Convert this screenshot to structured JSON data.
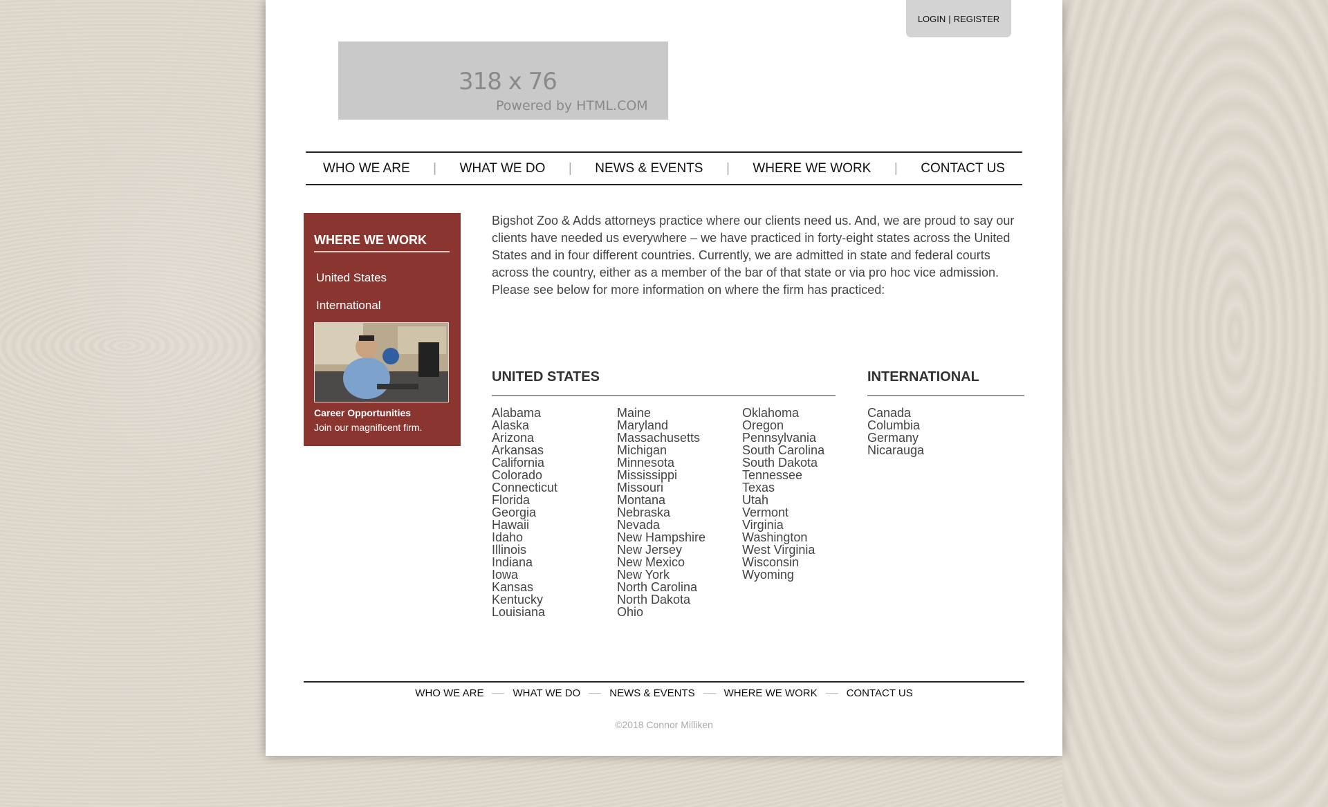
{
  "header": {
    "login_label": "LOGIN",
    "register_label": "REGISTER",
    "login_divider": "|",
    "logo_size_text": "318 x 76",
    "logo_powered_text": "Powered by HTML.COM"
  },
  "nav": {
    "items": [
      "WHO WE ARE",
      "WHAT WE DO",
      "NEWS & EVENTS",
      "WHERE WE WORK",
      "CONTACT US"
    ],
    "separator": "|"
  },
  "sidebar": {
    "title": "WHERE WE WORK",
    "links": [
      "United States",
      "International"
    ],
    "career_title": "Career Opportunities",
    "career_text": "Join our magnificent firm."
  },
  "intro": "Bigshot Zoo & Adds attorneys practice where our clients need us. And, we are proud to say our clients have needed us everywhere – we have practiced in forty-eight states across the United States and in four different countries. Currently, we are admitted in state and federal courts across the country, either as a member of the bar of that state or via pro hoc vice admission. Please see below for more information on where the firm has practiced:",
  "us": {
    "heading": "UNITED STATES",
    "col1": [
      "Alabama",
      "Alaska",
      "Arizona",
      "Arkansas",
      "California",
      "Colorado",
      "Connecticut",
      "Florida",
      "Georgia",
      "Hawaii",
      "Idaho",
      "Illinois",
      "Indiana",
      "Iowa",
      "Kansas",
      "Kentucky",
      "Louisiana"
    ],
    "col2": [
      "Maine",
      "Maryland",
      "Massachusetts",
      "Michigan",
      "Minnesota",
      "Mississippi",
      "Missouri",
      "Montana",
      "Nebraska",
      "Nevada",
      "New Hampshire",
      "New Jersey",
      "New Mexico",
      "New York",
      "North Carolina",
      "North Dakota",
      "Ohio"
    ],
    "col3": [
      "Oklahoma",
      "Oregon",
      "Pennsylvania",
      "South Carolina",
      "South Dakota",
      "Tennessee",
      "Texas",
      "Utah",
      "Vermont",
      "Virginia",
      "Washington",
      "West Virginia",
      "Wisconsin",
      "Wyoming"
    ]
  },
  "international": {
    "heading": "INTERNATIONAL",
    "countries": [
      "Canada",
      "Columbia",
      "Germany",
      "Nicarauga"
    ]
  },
  "footer": {
    "items": [
      "WHO WE ARE",
      "WHAT WE DO",
      "NEWS & EVENTS",
      "WHERE WE WORK",
      "CONTACT US"
    ],
    "copyright": "©2018 Connor Milliken"
  }
}
